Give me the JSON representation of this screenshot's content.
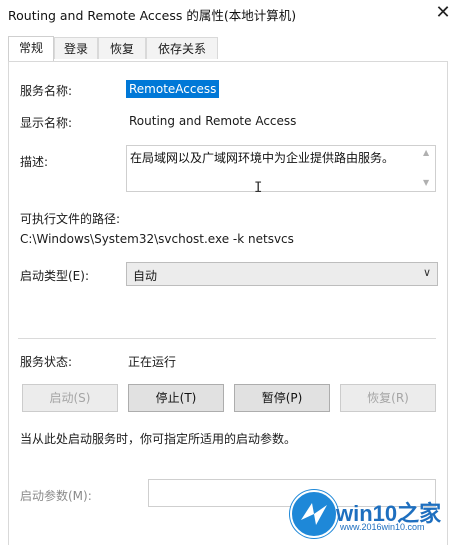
{
  "window": {
    "title": "Routing and Remote Access 的属性(本地计算机)",
    "close_glyph": "✕"
  },
  "tabs": [
    {
      "label": "常规"
    },
    {
      "label": "登录"
    },
    {
      "label": "恢复"
    },
    {
      "label": "依存关系"
    }
  ],
  "general": {
    "service_name_label": "服务名称:",
    "service_name_value": "RemoteAccess",
    "display_name_label": "显示名称:",
    "display_name_value": "Routing and Remote Access",
    "description_label": "描述:",
    "description_value": "在局域网以及广域网环境中为企业提供路由服务。",
    "exe_path_label": "可执行文件的路径:",
    "exe_path_value": "C:\\Windows\\System32\\svchost.exe -k netsvcs",
    "startup_type_label": "启动类型(E):",
    "startup_type_value": "自动",
    "status_label": "服务状态:",
    "status_value": "正在运行",
    "buttons": {
      "start": "启动(S)",
      "stop": "停止(T)",
      "pause": "暂停(P)",
      "resume": "恢复(R)"
    },
    "hint": "当从此处启动服务时，你可指定所适用的启动参数。",
    "params_label": "启动参数(M):",
    "params_value": ""
  },
  "watermark": {
    "brand": "win10之家",
    "url": "www.2016win10.com"
  },
  "colors": {
    "selection": "#0078d7",
    "watermark": "#1e6fbf"
  }
}
